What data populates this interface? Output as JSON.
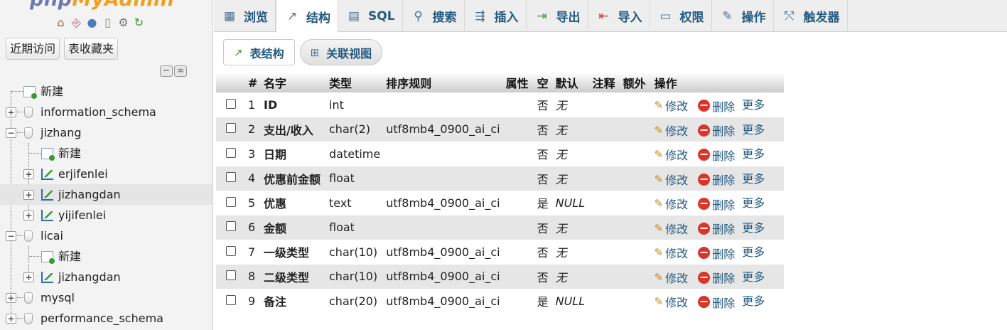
{
  "nav": {
    "logo": {
      "php": "php",
      "my": "MyAdmin"
    },
    "icons": [
      "home-icon",
      "exit-icon",
      "help-icon",
      "docs-icon",
      "settings-icon",
      "reload-icon"
    ],
    "tabs": {
      "recent": "近期访问",
      "favorites": "表收藏夹"
    },
    "tree": {
      "new_root": "新建",
      "information_schema": "information_schema",
      "jizhang": "jizhang",
      "jizhang_new": "新建",
      "erjifenlei": "erjifenlei",
      "jizhangdan": "jizhangdan",
      "yijifenlei": "yijifenlei",
      "licai": "licai",
      "licai_new": "新建",
      "licai_jizhangdan": "jizhangdan",
      "mysql": "mysql",
      "performance_schema": "performance_schema"
    }
  },
  "menu": {
    "browse": "浏览",
    "structure": "结构",
    "sql": "SQL",
    "search": "搜索",
    "insert": "插入",
    "export": "导出",
    "import": "导入",
    "privileges": "权限",
    "operations": "操作",
    "triggers": "触发器"
  },
  "subtabs": {
    "table_structure": "表结构",
    "relation_view": "关联视图"
  },
  "table": {
    "headers": {
      "num": "#",
      "name": "名字",
      "type": "类型",
      "collation": "排序规则",
      "attributes": "属性",
      "null": "空",
      "default": "默认",
      "comments": "注释",
      "extra": "额外",
      "action": "操作"
    },
    "actions": {
      "change": "修改",
      "drop": "删除",
      "more": "更多"
    },
    "rows": [
      {
        "num": "1",
        "name": "ID",
        "type": "int",
        "collation": "",
        "null": "否",
        "default": "无"
      },
      {
        "num": "2",
        "name": "支出/收入",
        "type": "char(2)",
        "collation": "utf8mb4_0900_ai_ci",
        "null": "否",
        "default": "无"
      },
      {
        "num": "3",
        "name": "日期",
        "type": "datetime",
        "collation": "",
        "null": "否",
        "default": "无"
      },
      {
        "num": "4",
        "name": "优惠前金额",
        "type": "float",
        "collation": "",
        "null": "否",
        "default": "无"
      },
      {
        "num": "5",
        "name": "优惠",
        "type": "text",
        "collation": "utf8mb4_0900_ai_ci",
        "null": "是",
        "default": "NULL"
      },
      {
        "num": "6",
        "name": "金额",
        "type": "float",
        "collation": "",
        "null": "否",
        "default": "无"
      },
      {
        "num": "7",
        "name": "一级类型",
        "type": "char(10)",
        "collation": "utf8mb4_0900_ai_ci",
        "null": "否",
        "default": "无"
      },
      {
        "num": "8",
        "name": "二级类型",
        "type": "char(10)",
        "collation": "utf8mb4_0900_ai_ci",
        "null": "否",
        "default": "无"
      },
      {
        "num": "9",
        "name": "备注",
        "type": "char(20)",
        "collation": "utf8mb4_0900_ai_ci",
        "null": "是",
        "default": "NULL"
      }
    ]
  }
}
